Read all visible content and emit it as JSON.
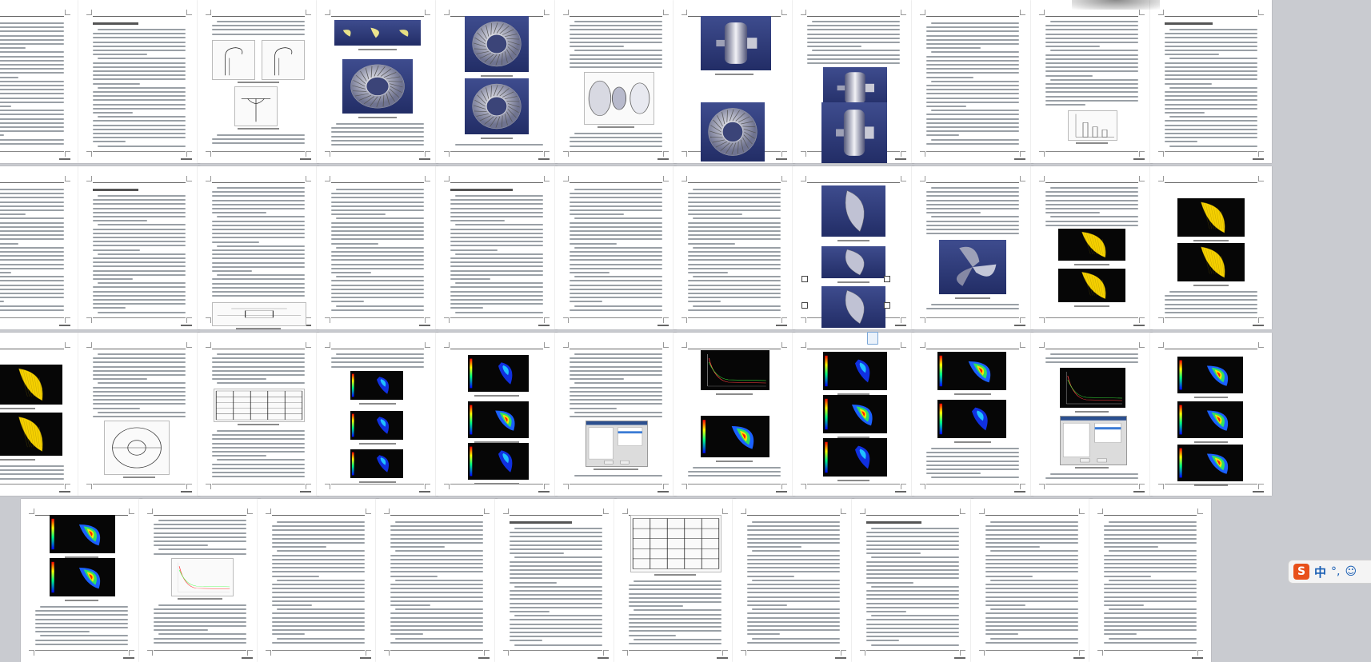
{
  "viewer": {
    "title": "",
    "layout": "thumbnail-grid",
    "rows": 4,
    "pages_per_row": [
      11,
      11,
      11,
      10
    ]
  },
  "colors": {
    "background": "#c9cbd0",
    "page": "#ffffff",
    "render_background": "#2b3570",
    "solver_background": "#060606",
    "ime_accent": "#e8501a"
  },
  "figures": [
    "blade-sketch",
    "blade-3d",
    "impeller-render",
    "pump-wheel-render",
    "turbine-render",
    "exploded-assembly",
    "torque-converter-render",
    "section-drawing",
    "graph-sketch",
    "blade-mesh",
    "blade-yellow-mesh",
    "pressure-contour",
    "residual-plot",
    "solver-dialog",
    "data-table",
    "flow-diagram"
  ],
  "ime": {
    "logo": "S",
    "mode_label": "中",
    "punct": "°,",
    "emoji_icon": "smiley-icon"
  }
}
